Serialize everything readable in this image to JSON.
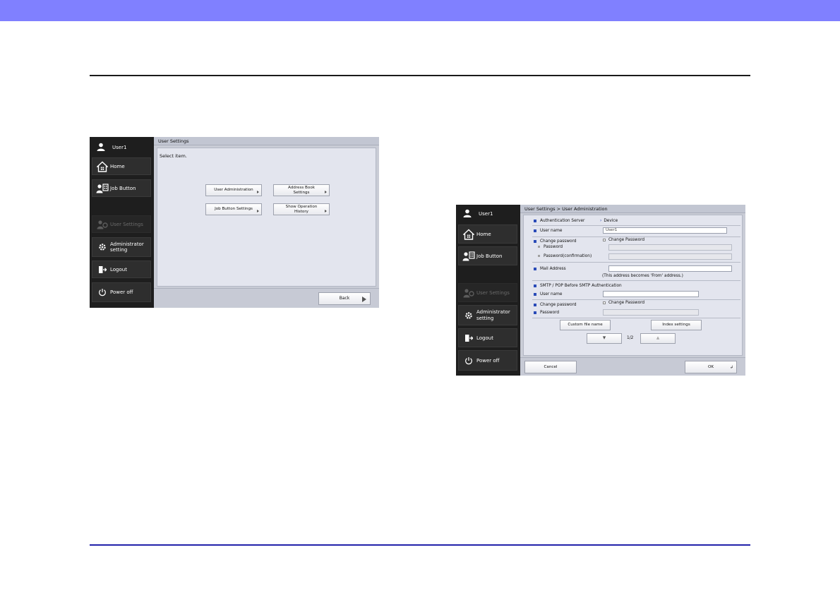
{
  "screen1": {
    "sidebar": {
      "user": "User1",
      "home": "Home",
      "job_button": "Job Button",
      "user_settings": "User Settings",
      "admin_line1": "Administrator",
      "admin_line2": "setting",
      "logout": "Logout",
      "power_off": "Power off"
    },
    "title": "User Settings",
    "instruction": "Select item.",
    "buttons": {
      "user_admin": "User Administration",
      "address_book_1": "Address Book",
      "address_book_2": "Settings",
      "job_button_settings": "Job Button Settings",
      "op_history_1": "Show Operation",
      "op_history_2": "History"
    },
    "back": "Back"
  },
  "screen2": {
    "sidebar": {
      "user": "User1",
      "home": "Home",
      "job_button": "Job Button",
      "user_settings": "User Settings",
      "admin_line1": "Administrator",
      "admin_line2": "setting",
      "logout": "Logout",
      "power_off": "Power off"
    },
    "title": "User Settings > User Administration",
    "auth_server_label": "Authentication Server",
    "auth_server_value": "Device",
    "user_name_label": "User name",
    "user_name_value": "User1",
    "change_password_label": "Change password",
    "change_password_check": "Change Password",
    "password_label": "Password",
    "password_confirm_label": "Password(confirmation)",
    "mail_label": "Mail Address",
    "mail_note": "(This address becomes 'From' address.)",
    "smtp_heading": "SMTP / POP Before SMTP Authentication",
    "smtp_user_label": "User name",
    "smtp_change_label": "Change password",
    "smtp_change_check": "Change Password",
    "smtp_password_label": "Password",
    "custom_file_name": "Custom file name",
    "index_settings": "Index settings",
    "page_indicator": "1/2",
    "down_arrow": "▼",
    "up_arrow": "▲",
    "cancel": "Cancel",
    "ok": "OK"
  }
}
